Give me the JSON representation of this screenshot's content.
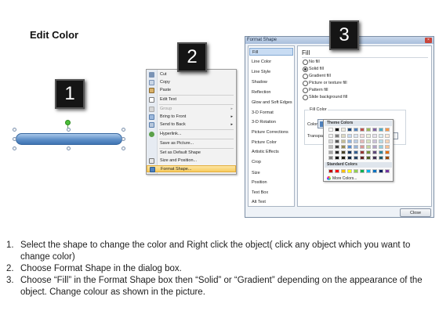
{
  "title": "Edit Color",
  "steps": [
    "1",
    "2",
    "3"
  ],
  "context_menu": {
    "items": [
      {
        "label": "Cut",
        "icon": "scissors-icon",
        "submenu": false,
        "disabled": false
      },
      {
        "label": "Copy",
        "icon": "copy-icon",
        "submenu": false,
        "disabled": false
      },
      {
        "label": "Paste",
        "icon": "paste-icon",
        "submenu": false,
        "disabled": false
      },
      {
        "label": "Edit Text",
        "icon": "edit-text-icon",
        "submenu": false,
        "disabled": false
      },
      {
        "label": "Group",
        "icon": "group-icon",
        "submenu": true,
        "disabled": true
      },
      {
        "label": "Bring to Front",
        "icon": "bring-front-icon",
        "submenu": true,
        "disabled": false
      },
      {
        "label": "Send to Back",
        "icon": "send-back-icon",
        "submenu": true,
        "disabled": false
      },
      {
        "label": "Hyperlink...",
        "icon": "hyperlink-icon",
        "submenu": false,
        "disabled": false
      },
      {
        "label": "Save as Picture...",
        "icon": "",
        "submenu": false,
        "disabled": false
      },
      {
        "label": "Set as Default Shape",
        "icon": "",
        "submenu": false,
        "disabled": false
      },
      {
        "label": "Size and Position...",
        "icon": "size-icon",
        "submenu": false,
        "disabled": false
      },
      {
        "label": "Format Shape...",
        "icon": "format-shape-icon",
        "submenu": false,
        "disabled": false,
        "highlighted": true
      }
    ]
  },
  "dialog": {
    "title": "Format Shape",
    "close_button": "Close",
    "nav_items": [
      "Fill",
      "Line Color",
      "Line Style",
      "Shadow",
      "Reflection",
      "Glow and Soft Edges",
      "3-D Format",
      "3-D Rotation",
      "Picture Corrections",
      "Picture Color",
      "Artistic Effects",
      "Crop",
      "Size",
      "Position",
      "Text Box",
      "Alt Text"
    ],
    "selected_nav": "Fill",
    "pane_heading": "Fill",
    "fill_options": [
      {
        "label": "No fill",
        "checked": false
      },
      {
        "label": "Solid fill",
        "checked": true
      },
      {
        "label": "Gradient fill",
        "checked": false
      },
      {
        "label": "Picture or texture fill",
        "checked": false
      },
      {
        "label": "Pattern fill",
        "checked": false
      },
      {
        "label": "Slide background fill",
        "checked": false
      }
    ],
    "fill_color_group": "Fill Color",
    "color_label": "Color:",
    "transparency_label": "Transpa"
  },
  "palette": {
    "theme_heading": "Theme Colors",
    "standard_heading": "Standard Colors",
    "more_colors": "More Colors...",
    "theme_top": [
      "#ffffff",
      "#000000",
      "#eeece1",
      "#1f497d",
      "#4f81bd",
      "#c0504d",
      "#9bbb59",
      "#8064a2",
      "#4bacc6",
      "#f79646"
    ],
    "theme_shades": [
      [
        "#f2f2f2",
        "#7f7f7f",
        "#ddd9c3",
        "#c6d9f0",
        "#dbe5f1",
        "#f2dcdb",
        "#ebf1dd",
        "#e5e0ec",
        "#dbeef3",
        "#fdeada"
      ],
      [
        "#d8d8d8",
        "#595959",
        "#c4bd97",
        "#8db3e2",
        "#b8cce4",
        "#e5b9b7",
        "#d7e3bc",
        "#ccc1d9",
        "#b7dde8",
        "#fbd5b5"
      ],
      [
        "#bfbfbf",
        "#3f3f3f",
        "#938953",
        "#548dd4",
        "#95b3d7",
        "#d99694",
        "#c3d69b",
        "#b2a2c7",
        "#92cddc",
        "#fac08f"
      ],
      [
        "#a5a5a5",
        "#262626",
        "#494429",
        "#17365d",
        "#366092",
        "#953734",
        "#76923c",
        "#5f497a",
        "#31859b",
        "#e36c09"
      ],
      [
        "#7f7f7f",
        "#0c0c0c",
        "#1d1b10",
        "#0f243e",
        "#244061",
        "#632423",
        "#4f6128",
        "#3f3151",
        "#205867",
        "#974806"
      ]
    ],
    "standard": [
      "#c00000",
      "#ff0000",
      "#ffc000",
      "#ffff00",
      "#92d050",
      "#00b050",
      "#00b0f0",
      "#0070c0",
      "#002060",
      "#7030a0"
    ]
  },
  "instructions": [
    {
      "num": "1.",
      "text": "Select the shape to change the color and Right click the object( click any object which you want to change color)"
    },
    {
      "num": "2.",
      "text": "Choose Format Shape in the dialog box."
    },
    {
      "num": "3.",
      "text": "Choose “Fill” in the Format Shape box then “Solid” or “Gradient” depending on the appearance of the object. Change colour as shown in the picture."
    }
  ],
  "colors": {
    "shape_fill": "#4f81bd",
    "menu_highlight": "#f8cb5e",
    "dialog_frame": "#a9bfdc"
  }
}
